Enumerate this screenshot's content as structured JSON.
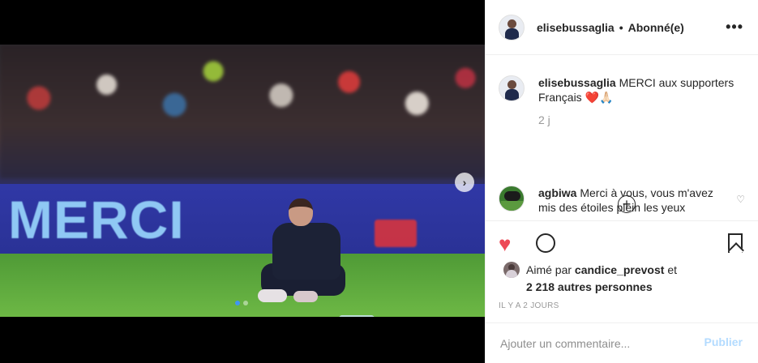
{
  "post": {
    "username": "elisebussaglia",
    "follow_status": "Abonné(e)",
    "separator": "•",
    "more_icon": "•••"
  },
  "media": {
    "board_text": "MERCI",
    "next_icon": "›",
    "dots": 2,
    "active_dot": 1
  },
  "caption": {
    "username": "elisebussaglia",
    "text": "MERCI aux supporters Français ❤️🙏🏻",
    "time": "2 j"
  },
  "load_more_icon": "+",
  "comment": {
    "username": "agbiwa",
    "text": "Merci à vous, vous m'avez mis des étoiles plein les yeux",
    "like_icon": "♡"
  },
  "actions": {
    "heart_icon": "♥",
    "liked_by_prefix": "Aimé par",
    "liked_by_user": "candice_prevost",
    "liked_by_and": "et",
    "others": "2 218 autres personnes",
    "time_ago": "IL Y A 2 JOURS"
  },
  "add_comment": {
    "placeholder": "Ajouter un commentaire...",
    "publish_label": "Publier"
  },
  "colors": {
    "like_red": "#ed4956",
    "publish_disabled": "#b3dbff",
    "dot_active": "#3f96f4"
  }
}
